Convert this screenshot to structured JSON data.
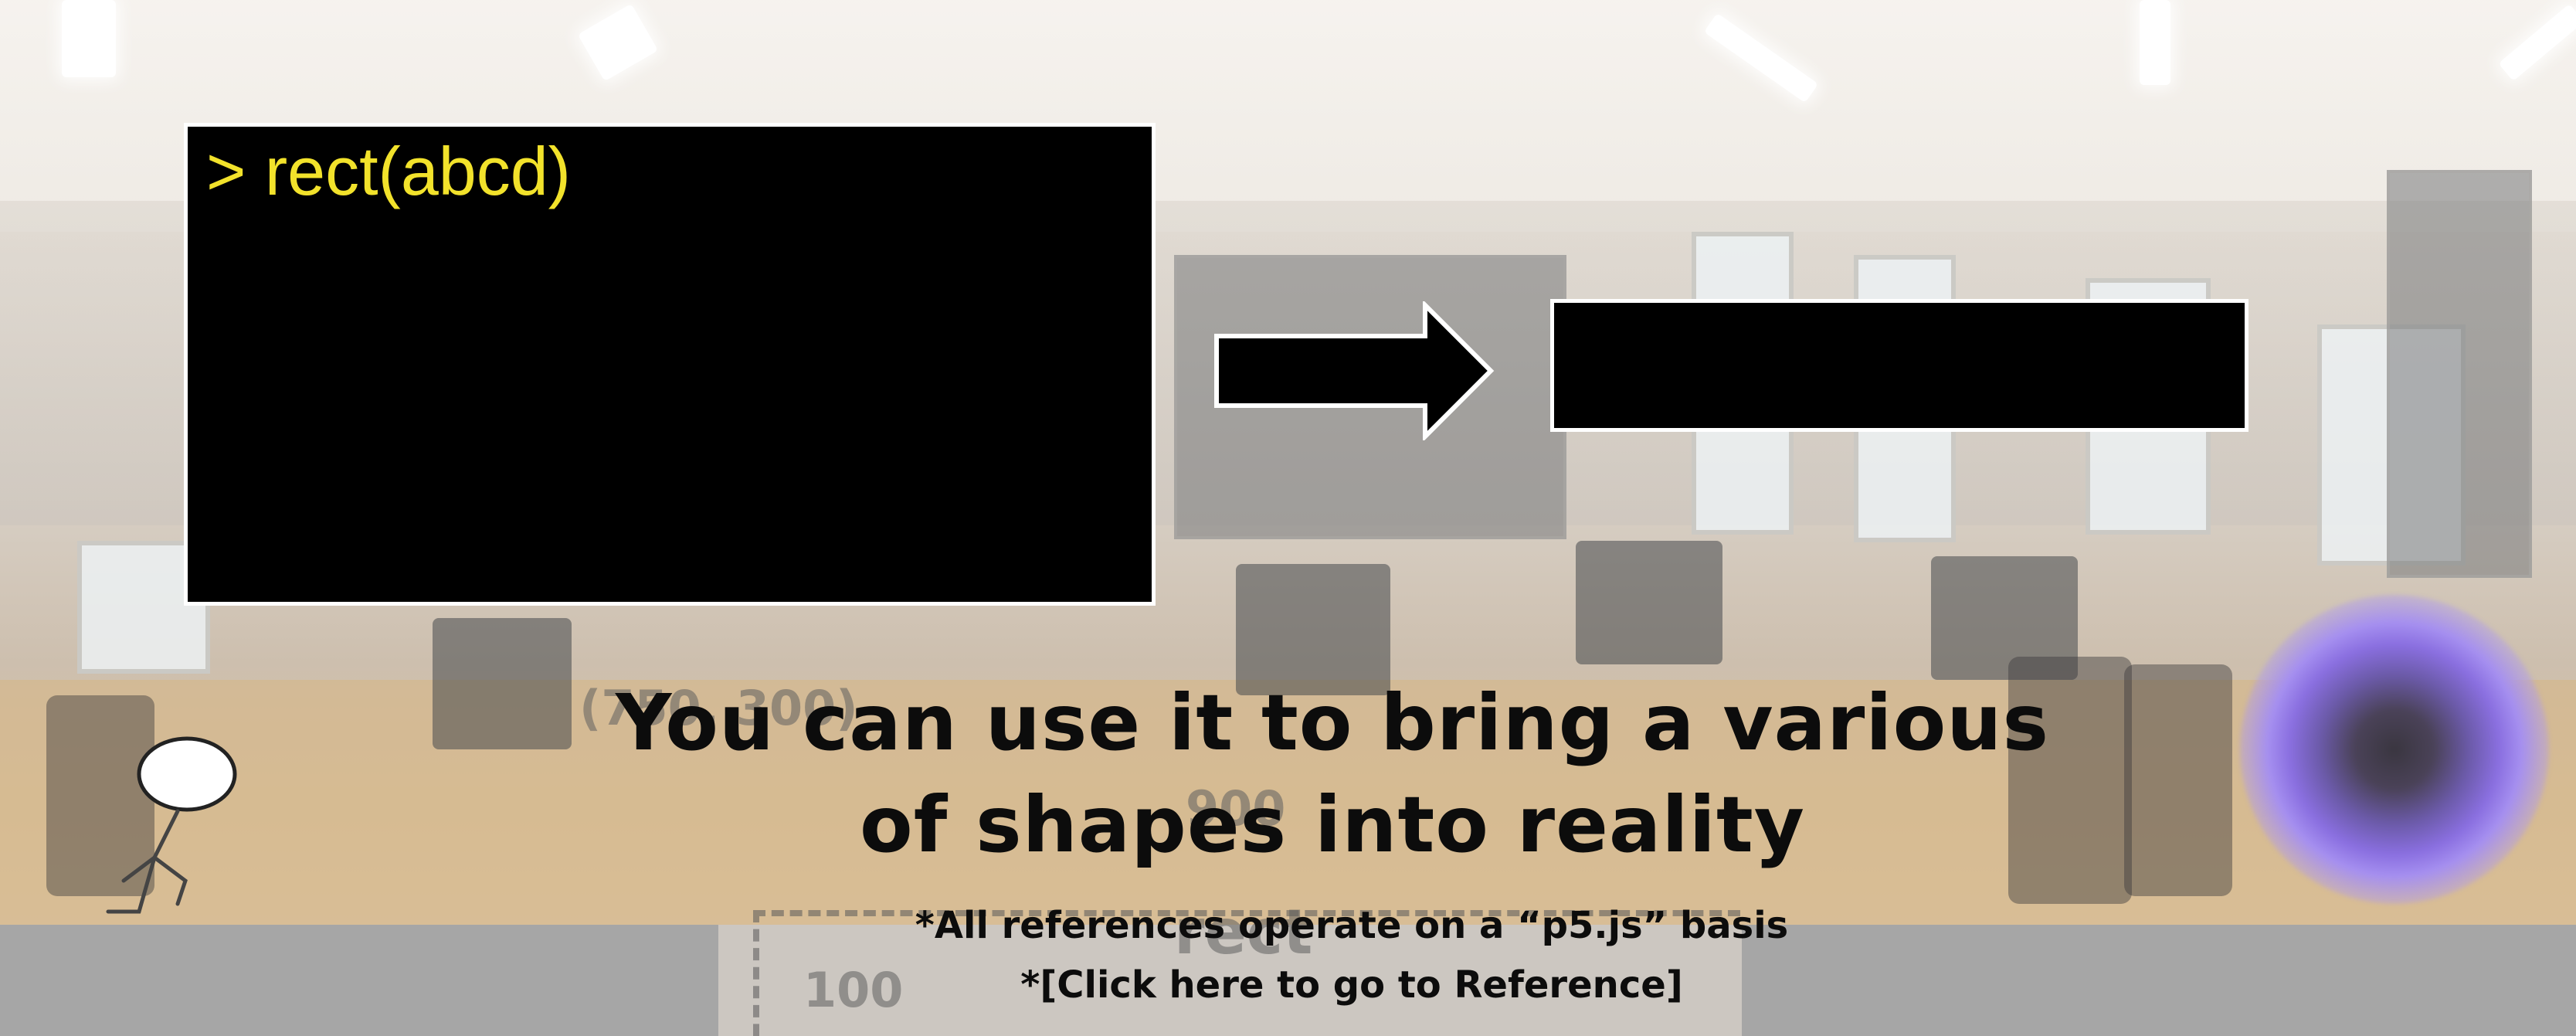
{
  "terminal": {
    "command": "> rect(abcd)"
  },
  "scene": {
    "caption_line1": "You can use it to bring a various",
    "caption_line2": "of shapes into reality",
    "basis_note": "*All references operate on a “p5.js” basis",
    "reference_link": "*[Click here to go to Reference]"
  },
  "background_hints": {
    "coord_label": "(750, 300)",
    "width_label": "900",
    "height_label": "100",
    "shape_label": "rect"
  },
  "colors": {
    "terminal_text": "#f2e22b",
    "panel_fill": "#000000",
    "panel_border": "#ffffff",
    "caption_text": "#0c0c0c",
    "bottom_band": "#a6a6a6"
  },
  "icons": {
    "arrow": "right-arrow-icon",
    "figure": "stick-figure-icon",
    "portal": "portal-icon"
  }
}
